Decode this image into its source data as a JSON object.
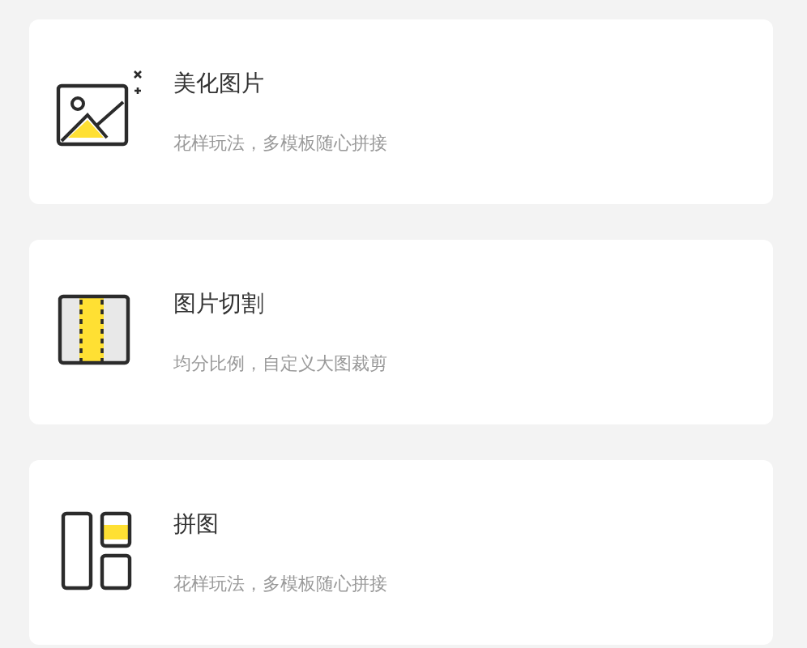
{
  "features": [
    {
      "kind": "beautify",
      "title": "美化图片",
      "subtitle": "花样玩法，多模板随心拼接"
    },
    {
      "kind": "cut",
      "title": "图片切割",
      "subtitle": "均分比例，自定义大图裁剪"
    },
    {
      "kind": "collage",
      "title": "拼图",
      "subtitle": "花样玩法，多模板随心拼接"
    }
  ]
}
